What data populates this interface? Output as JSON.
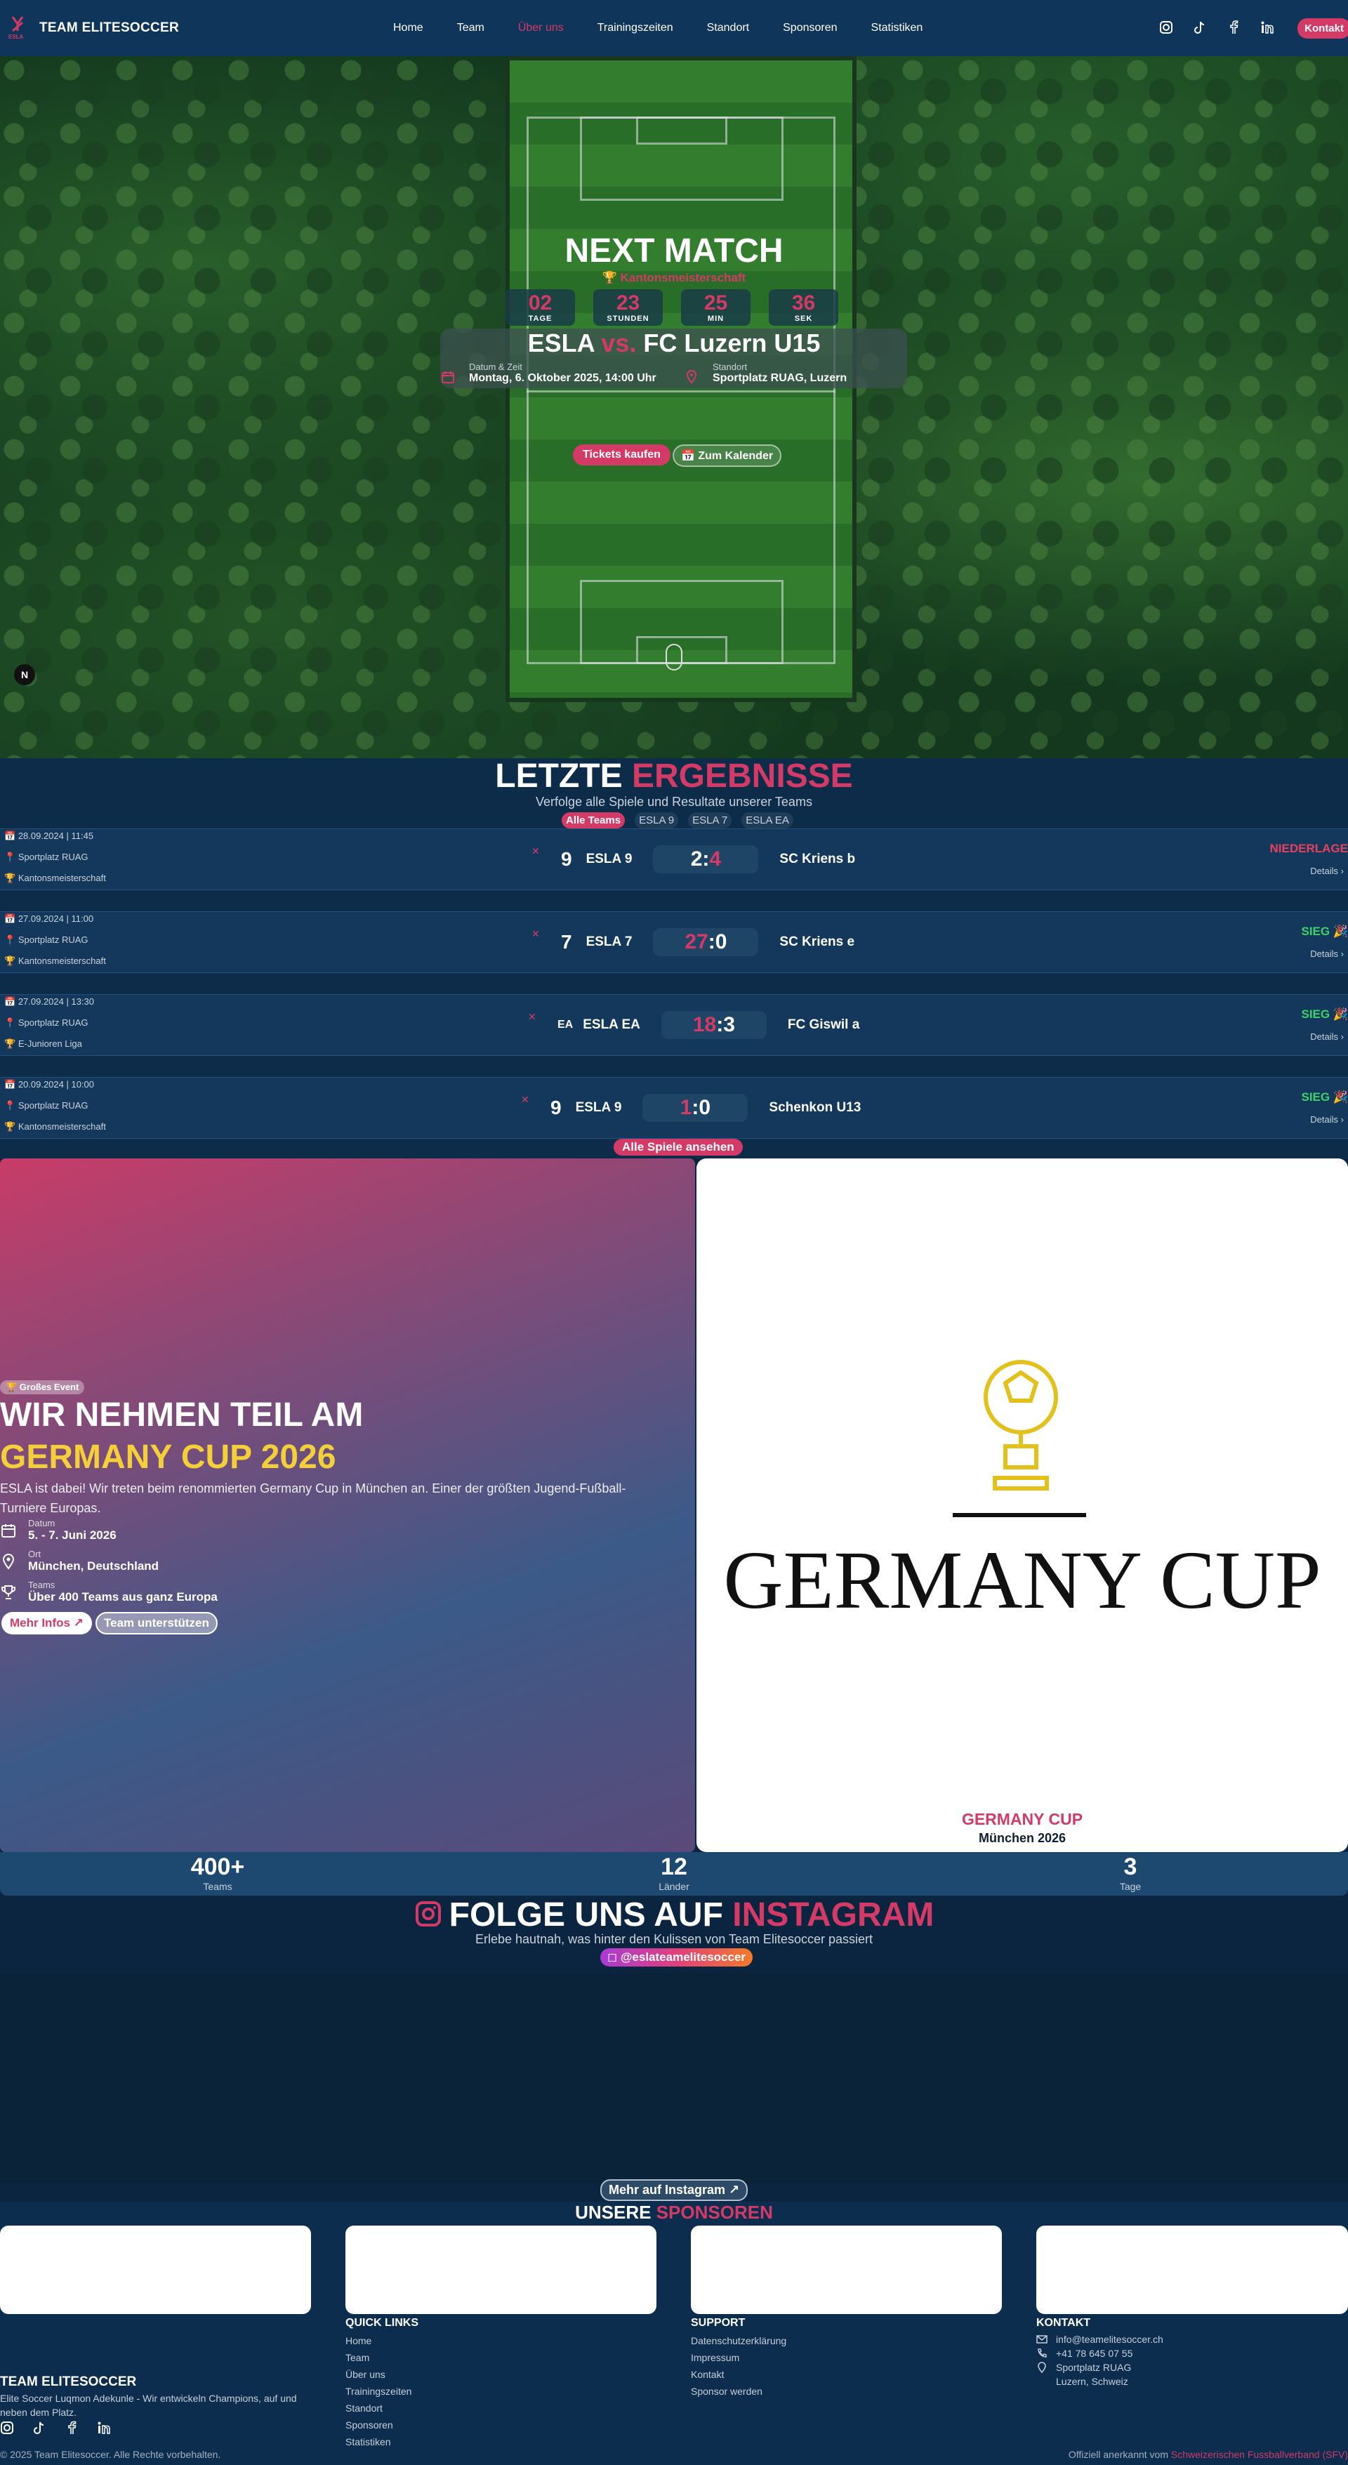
{
  "nav": {
    "brand": "TEAM ELITESOCCER",
    "logo_text": "ESLA",
    "items": [
      "Home",
      "Team",
      "Über uns",
      "Trainingszeiten",
      "Standort",
      "Sponsoren",
      "Statistiken"
    ],
    "active_index": 2,
    "socials": [
      "instagram-icon",
      "tiktok-icon",
      "facebook-icon",
      "linkedin-icon"
    ],
    "contact_label": "Kontakt"
  },
  "hero": {
    "title": "NEXT MATCH",
    "competition": "Kantonsmeisterschaft",
    "countdown": [
      {
        "value": "02",
        "label": "TAGE"
      },
      {
        "value": "23",
        "label": "STUNDEN"
      },
      {
        "value": "25",
        "label": "MIN"
      },
      {
        "value": "36",
        "label": "SEK"
      }
    ],
    "home_team": "ESLA",
    "vs": "vs.",
    "away_team": "FC Luzern U15",
    "datetime_label": "Datum & Zeit",
    "datetime_value": "Montag, 6. Oktober 2025, 14:00 Uhr",
    "location_label": "Standort",
    "location_value": "Sportplatz RUAG, Luzern",
    "tickets_label": "Tickets kaufen",
    "calendar_label": "Zum Kalender",
    "corner_badge": "N"
  },
  "results": {
    "title_white": "LETZTE",
    "title_pink": "ERGEBNISSE",
    "subtitle": "Verfolge alle Spiele und Resultate unserer Teams",
    "filters": [
      "Alle Teams",
      "ESLA 9",
      "ESLA 7",
      "ESLA EA"
    ],
    "active_filter": 0,
    "details_label": "Details",
    "all_games_label": "Alle Spiele ansehen",
    "rows": [
      {
        "datetime": "28.09.2024 | 11:45",
        "place": "Sportplatz RUAG",
        "competition": "Kantonsmeisterschaft",
        "badge": "9",
        "team": "ESLA 9",
        "score_home": "2",
        "score_away": "4",
        "opponent": "SC Kriens b",
        "status": "NIEDERLAGE",
        "win": false
      },
      {
        "datetime": "27.09.2024 | 11:00",
        "place": "Sportplatz RUAG",
        "competition": "Kantonsmeisterschaft",
        "badge": "7",
        "team": "ESLA 7",
        "score_home": "27",
        "score_away": "0",
        "opponent": "SC Kriens e",
        "status": "SIEG 🎉",
        "win": true
      },
      {
        "datetime": "27.09.2024 | 13:30",
        "place": "Sportplatz RUAG",
        "competition": "E-Junioren Liga",
        "badge": "EA",
        "team": "ESLA EA",
        "score_home": "18",
        "score_away": "3",
        "opponent": "FC Giswil a",
        "status": "SIEG 🎉",
        "win": true
      },
      {
        "datetime": "20.09.2024 | 10:00",
        "place": "Sportplatz RUAG",
        "competition": "Kantonsmeisterschaft",
        "badge": "9",
        "team": "ESLA 9",
        "score_home": "1",
        "score_away": "0",
        "opponent": "Schenkon U13",
        "status": "SIEG 🎉",
        "win": true
      }
    ]
  },
  "event": {
    "badge": "🏆 Großes Event",
    "title_line1": "WIR NEHMEN TEIL AM",
    "title_line2": "GERMANY CUP 2026",
    "description": "ESLA ist dabei! Wir treten beim renommierten Germany Cup in München an. Einer der größten Jugend-Fußball-Turniere Europas.",
    "date_label": "Datum",
    "date_value": "5. - 7. Juni 2026",
    "place_label": "Ort",
    "place_value": "München, Deutschland",
    "teams_label": "Teams",
    "teams_value": "Über 400 Teams aus ganz Europa",
    "more_label": "Mehr Infos",
    "support_label": "Team unterstützen",
    "logo_word": "GERMANY CUP",
    "caption_title": "GERMANY CUP",
    "caption_sub": "München 2026",
    "stats": [
      {
        "value": "400+",
        "label": "Teams"
      },
      {
        "value": "12",
        "label": "Länder"
      },
      {
        "value": "3",
        "label": "Tage"
      }
    ]
  },
  "instagram": {
    "title_white": "FOLGE UNS AUF",
    "title_pink": "INSTAGRAM",
    "subtitle": "Erlebe hautnah, was hinter den Kulissen von Team Elitesoccer passiert",
    "handle": "@eslateamelitesoccer",
    "more_label": "Mehr auf Instagram"
  },
  "sponsors": {
    "title_white": "UNSERE",
    "title_pink": "SPONSOREN"
  },
  "footer": {
    "brand": "TEAM ELITESOCCER",
    "description": "Elite Soccer Luqmon Adekunle - Wir entwickeln Champions, auf und neben dem Platz.",
    "quick_title": "QUICK LINKS",
    "quick_links": [
      "Home",
      "Team",
      "Über uns",
      "Trainingszeiten",
      "Standort",
      "Sponsoren",
      "Statistiken"
    ],
    "support_title": "SUPPORT",
    "support_links": [
      "Datenschutzerklärung",
      "Impressum",
      "Kontakt",
      "Sponsor werden"
    ],
    "contact_title": "KONTAKT",
    "email": "info@teamelitesoccer.ch",
    "phone": "+41 78 645 07 55",
    "address1": "Sportplatz RUAG",
    "address2": "Luzern, Schweiz",
    "copyright": "© 2025 Team Elitesoccer. Alle Rechte vorbehalten.",
    "official_prefix": "Offiziell anerkannt vom",
    "official_link": "Schweizerischen Fussballverband (SFV)"
  },
  "colors": {
    "accent": "#d43a66",
    "navy": "#0b2540",
    "gold": "#f4cf3a",
    "win": "#3cd36a",
    "loss": "#e84060"
  }
}
